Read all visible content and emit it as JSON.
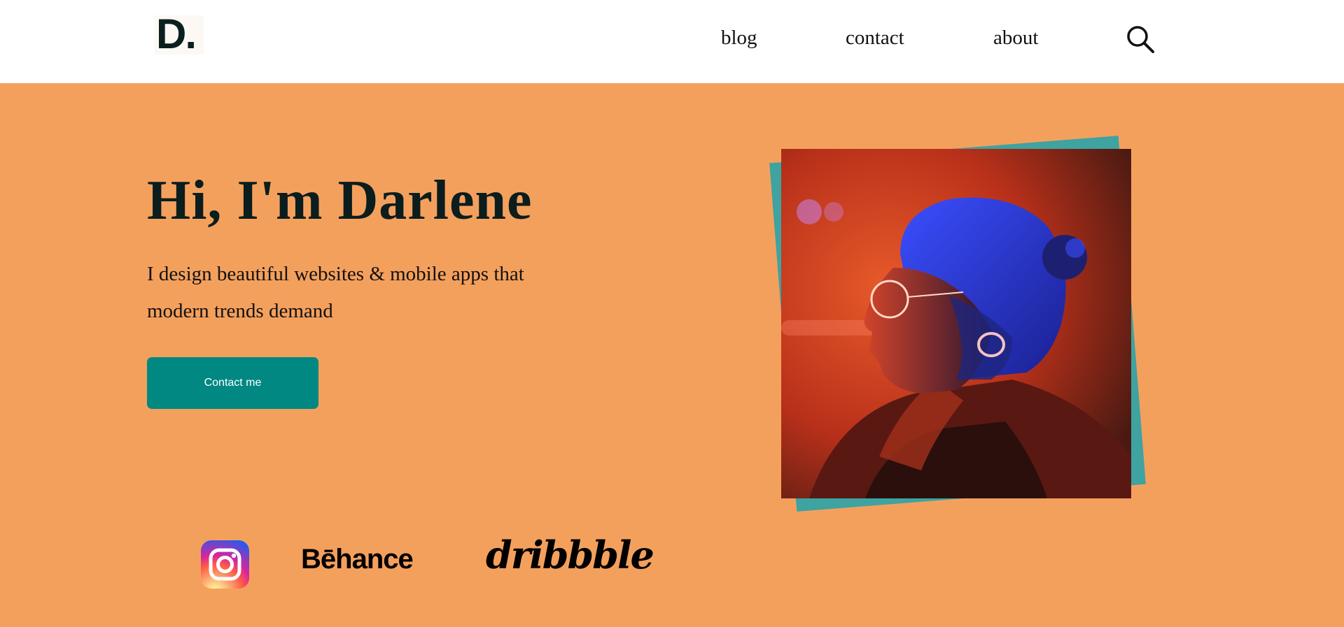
{
  "header": {
    "logo_text": "D.",
    "nav": {
      "blog": "blog",
      "contact": "contact",
      "about": "about"
    },
    "search_icon": "search-icon"
  },
  "hero": {
    "title": "Hi, I'm Darlene",
    "subtitle": "I design beautiful websites & mobile apps that modern trends demand",
    "cta_label": "Contact me"
  },
  "social": {
    "instagram_icon": "instagram-icon",
    "behance_label": "Bēhance",
    "dribbble_label": "dribbble"
  },
  "colors": {
    "background": "#f4a05d",
    "accent": "#018882",
    "photo_frame": "#3ea3a1",
    "text_dark": "#0b1d1d"
  }
}
